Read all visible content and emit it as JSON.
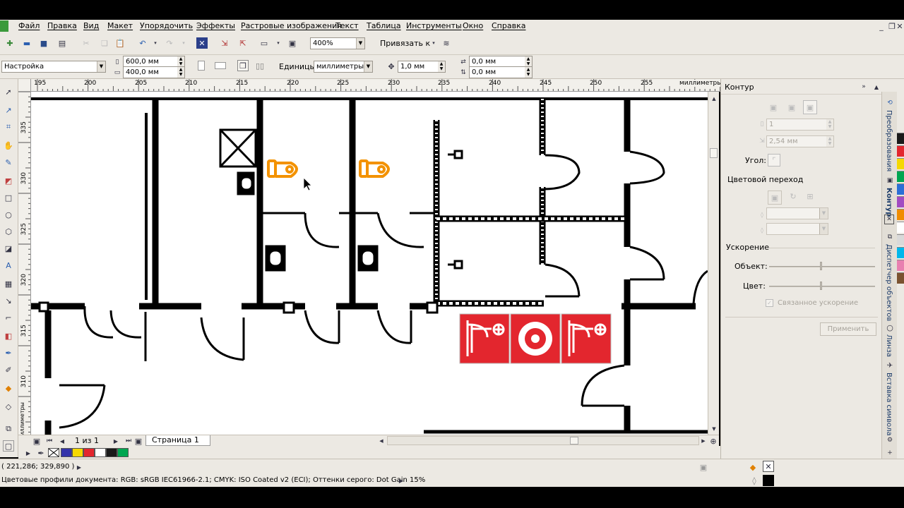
{
  "menu": [
    "Файл",
    "Правка",
    "Вид",
    "Макет",
    "Упорядочить",
    "Эффекты",
    "Растровые изображения",
    "Текст",
    "Таблица",
    "Инструменты",
    "Окно",
    "Справка"
  ],
  "toolbar1": {
    "zoom_value": "400%",
    "snap_label": "Привязать к"
  },
  "toolbar2": {
    "preset_value": "Настройка",
    "width_value": "600,0 мм",
    "height_value": "400,0 мм",
    "units_label": "Единицы:",
    "units_value": "миллиметры",
    "nudge_value": "1,0 мм",
    "dup_x_value": "0,0 мм",
    "dup_y_value": "0,0 мм"
  },
  "ruler": {
    "h_ticks": [
      "195",
      "200",
      "205",
      "210",
      "215",
      "220",
      "225",
      "230",
      "235",
      "240",
      "245",
      "250",
      "255"
    ],
    "h_unit": "миллиметры",
    "v_ticks": [
      "335",
      "330",
      "325",
      "320",
      "315",
      "310"
    ],
    "v_unit": "миллиметры"
  },
  "page_nav": {
    "counter": "1 из 1",
    "page_tab": "Страница 1"
  },
  "palette_colors": [
    "#3333aa",
    "#f5d800",
    "#e3262e",
    "#ffffff",
    "#1a1a1a",
    "#00a651"
  ],
  "right_palette_colors": [
    "#1a1a1a",
    "#e3262e",
    "#f5d800",
    "#00a651",
    "#2b6fd6",
    "#a24bc2",
    "#f08c00",
    "#ffffff",
    "#d9d9d9",
    "#00b7eb",
    "#e87fb0",
    "#7a5230"
  ],
  "panel": {
    "title": "Контур",
    "width_value": "1",
    "size_value": "2,54 мм",
    "angle_label": "Угол:",
    "blend_label": "Цветовой переход",
    "accel_label": "Ускорение",
    "object_label": "Объект:",
    "color_label": "Цвет:",
    "linked_label": "Связанное ускорение",
    "apply_label": "Применить"
  },
  "right_tabs": [
    "Преобразования",
    "Контур",
    "Диспетчер объектов",
    "Линза",
    "Вставка символа"
  ],
  "status": {
    "coords": "( 221,286; 329,890 )",
    "color_profiles": "Цветовые профили документа: RGB: sRGB IEC61966-2.1; CMYK: ISO Coated v2 (ECI); Оттенки серого: Dot Gain 15%"
  },
  "colors": {
    "accent_orange": "#f39200",
    "fire_red": "#e3262e",
    "app_bg": "#ece9e3"
  }
}
